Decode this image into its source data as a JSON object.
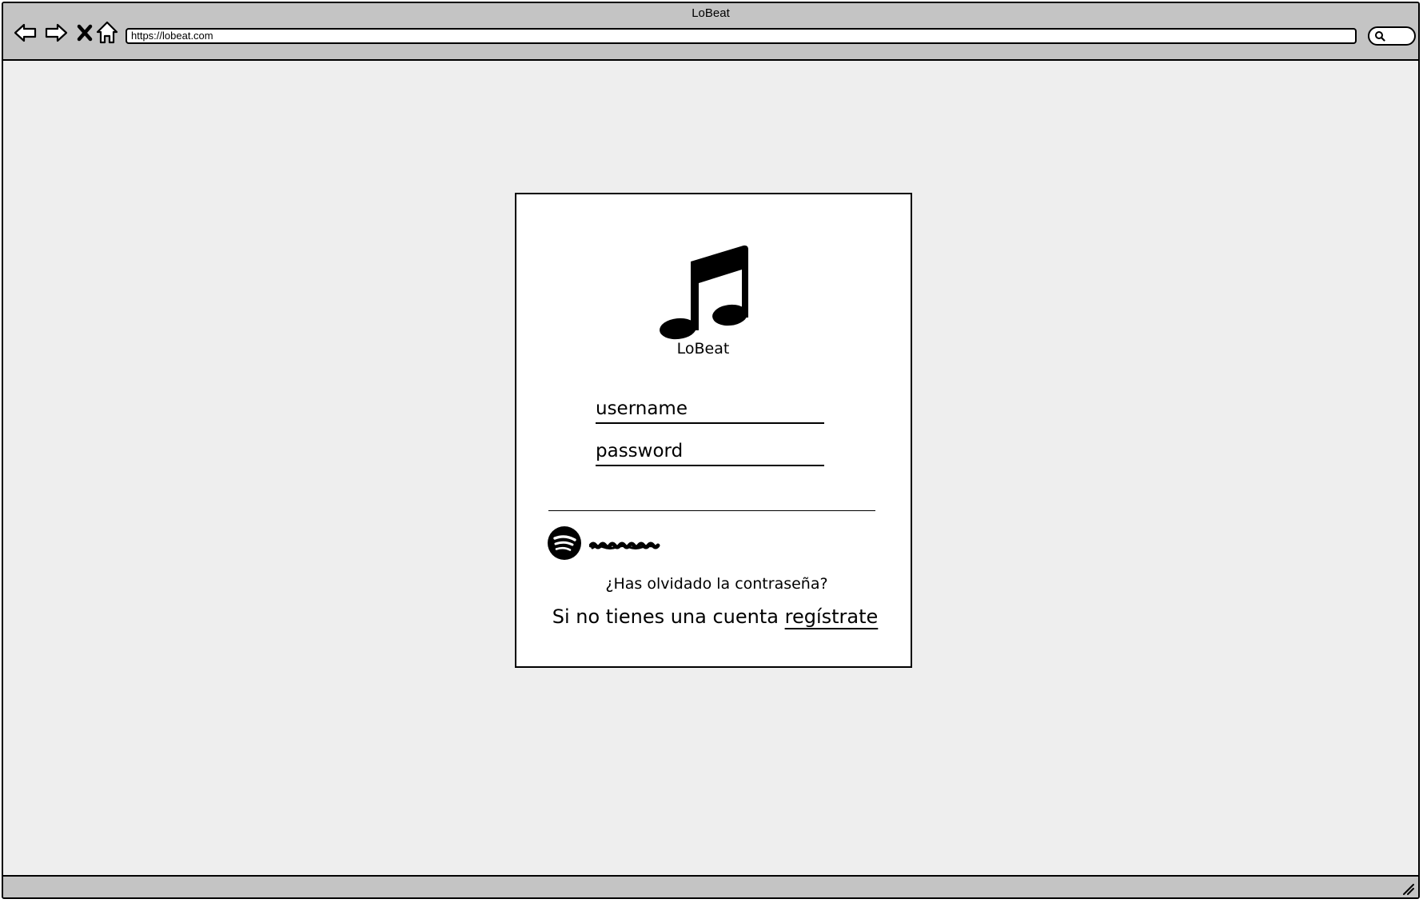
{
  "window": {
    "title": "LoBeat"
  },
  "toolbar": {
    "back_icon": "back-arrow-icon",
    "forward_icon": "forward-arrow-icon",
    "stop_icon": "close-x-icon",
    "home_icon": "home-icon",
    "url": "https://lobeat.com",
    "search_icon": "search-icon"
  },
  "login": {
    "logo_icon": "music-note-icon",
    "brand": "LoBeat",
    "username_label": "username",
    "password_label": "password",
    "spotify_icon": "spotify-icon",
    "forgot_password": "¿Has olvidado la contraseña?",
    "no_account_text": "Si no tienes una cuenta ",
    "register_link": "regístrate"
  },
  "colors": {
    "chrome": "#c4c4c4",
    "canvas": "#eeeeee",
    "card": "#ffffff",
    "ink": "#000000"
  }
}
